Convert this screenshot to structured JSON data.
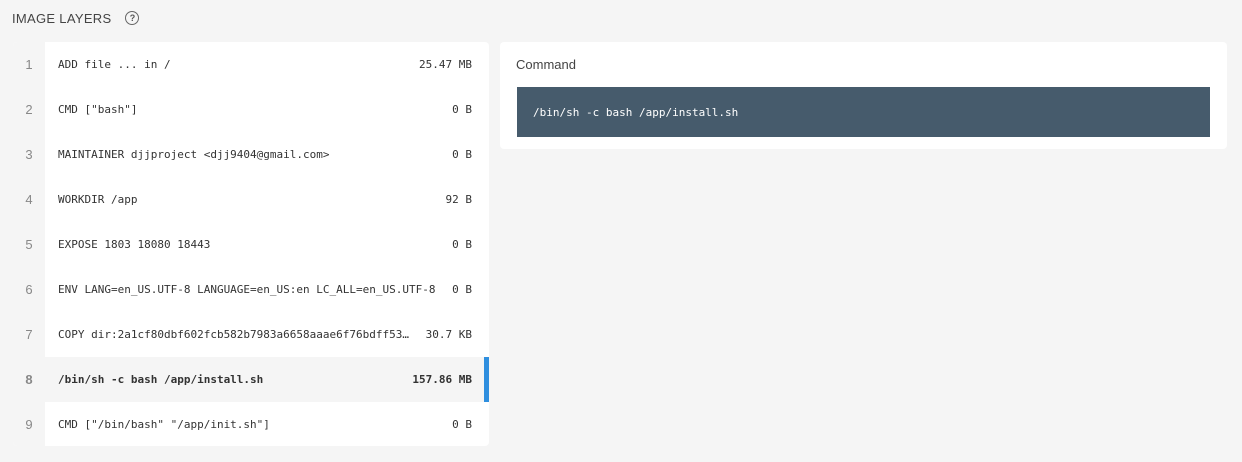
{
  "header": {
    "title": "IMAGE LAYERS",
    "help_icon": "?"
  },
  "layers": [
    {
      "index": "1",
      "command": "ADD file ... in /",
      "size": "25.47 MB"
    },
    {
      "index": "2",
      "command": "CMD [\"bash\"]",
      "size": "0 B"
    },
    {
      "index": "3",
      "command": "MAINTAINER djjproject <djj9404@gmail.com>",
      "size": "0 B"
    },
    {
      "index": "4",
      "command": "WORKDIR /app",
      "size": "92 B"
    },
    {
      "index": "5",
      "command": "EXPOSE 1803 18080 18443",
      "size": "0 B"
    },
    {
      "index": "6",
      "command": "ENV LANG=en_US.UTF-8 LANGUAGE=en_US:en LC_ALL=en_US.UTF-8",
      "size": "0 B"
    },
    {
      "index": "7",
      "command": "COPY dir:2a1cf80dbf602fcb582b7983a6658aaae6f76bdff53…",
      "size": "30.7 KB"
    },
    {
      "index": "8",
      "command": "/bin/sh -c bash /app/install.sh",
      "size": "157.86 MB",
      "selected": true
    },
    {
      "index": "9",
      "command": "CMD [\"/bin/bash\" \"/app/init.sh\"]",
      "size": "0 B"
    }
  ],
  "command_panel": {
    "label": "Command",
    "value": "/bin/sh -c bash /app/install.sh"
  },
  "colors": {
    "background": "#f5f5f5",
    "selection_accent": "#2f8fdf",
    "command_box": "#465b6c"
  }
}
